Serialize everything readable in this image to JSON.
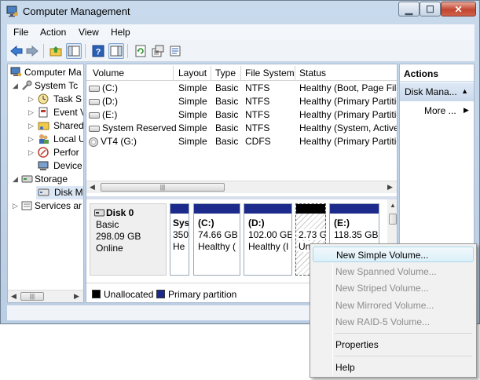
{
  "window": {
    "title": "Computer Management"
  },
  "menu": [
    "File",
    "Action",
    "View",
    "Help"
  ],
  "toolbar": [
    "back-arrow-icon",
    "forward-arrow-icon",
    "up-folder-icon",
    "show-hide-tree-icon",
    "help-icon",
    "show-hide-action-pane-icon",
    "refresh-icon",
    "export-icon",
    "properties-icon"
  ],
  "tree": {
    "root": "Computer Ma",
    "system_tools": "System Tc",
    "items": [
      "Task S",
      "Event V",
      "Shared",
      "Local U",
      "Perfor",
      "Device"
    ],
    "storage": "Storage",
    "disk_mgmt": "Disk M",
    "services": "Services ar"
  },
  "volumes": {
    "headers": [
      "Volume",
      "Layout",
      "Type",
      "File System",
      "Status"
    ],
    "rows": [
      [
        "(C:)",
        "Simple",
        "Basic",
        "NTFS",
        "Healthy (Boot, Page File"
      ],
      [
        "(D:)",
        "Simple",
        "Basic",
        "NTFS",
        "Healthy (Primary Partitio"
      ],
      [
        "(E:)",
        "Simple",
        "Basic",
        "NTFS",
        "Healthy (Primary Partitio"
      ],
      [
        "System Reserved",
        "Simple",
        "Basic",
        "NTFS",
        "Healthy (System, Active"
      ],
      [
        "VT4 (G:)",
        "Simple",
        "Basic",
        "CDFS",
        "Healthy (Primary Partitio"
      ]
    ]
  },
  "disk": {
    "name": "Disk 0",
    "type": "Basic",
    "size": "298.09 GB",
    "state": "Online",
    "partitions": [
      {
        "name": "Sys",
        "size": "350",
        "status": "He"
      },
      {
        "name": "(C:)",
        "size": "74.66 GB",
        "status": "Healthy ("
      },
      {
        "name": "(D:)",
        "size": "102.00 GB",
        "status": "Healthy (I"
      },
      {
        "name": "",
        "size": "2.73 G",
        "status": "Un"
      },
      {
        "name": "(E:)",
        "size": "118.35 GB",
        "status": ""
      }
    ]
  },
  "legend": {
    "unallocated": "Unallocated",
    "primary": "Primary partition"
  },
  "actions": {
    "header": "Actions",
    "sub": "Disk Mana...",
    "more": "More ..."
  },
  "context_menu": {
    "items": [
      {
        "label": "New Simple Volume...",
        "enabled": true
      },
      {
        "label": "New Spanned Volume...",
        "enabled": false
      },
      {
        "label": "New Striped Volume...",
        "enabled": false
      },
      {
        "label": "New Mirrored Volume...",
        "enabled": false
      },
      {
        "label": "New RAID-5 Volume...",
        "enabled": false
      },
      {
        "label": "Properties",
        "enabled": true
      },
      {
        "label": "Help",
        "enabled": true
      }
    ]
  },
  "colors": {
    "primary_partition": "#1c2a8c",
    "unallocated": "#000000",
    "accent": "#c9daed"
  }
}
